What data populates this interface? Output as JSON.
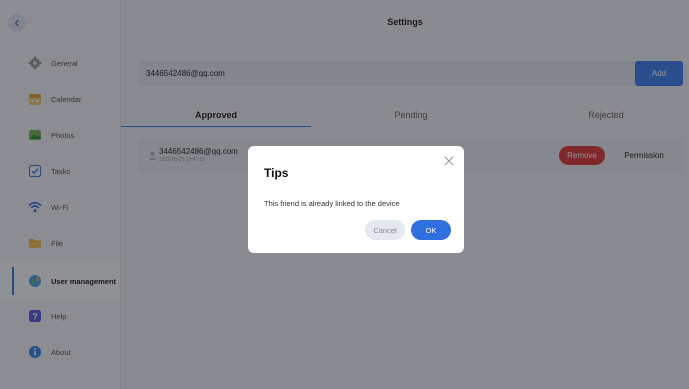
{
  "header": {
    "title": "Settings"
  },
  "sidebar": {
    "items": [
      {
        "label": "General",
        "icon": "gear-icon"
      },
      {
        "label": "Calendar",
        "icon": "calendar-icon"
      },
      {
        "label": "Photos",
        "icon": "photos-icon"
      },
      {
        "label": "Tasks",
        "icon": "tasks-icon"
      },
      {
        "label": "Wi-Fi",
        "icon": "wifi-icon"
      },
      {
        "label": "File",
        "icon": "folder-icon"
      },
      {
        "label": "User management",
        "icon": "user-management-icon"
      },
      {
        "label": "Help",
        "icon": "help-icon"
      },
      {
        "label": "About",
        "icon": "about-icon"
      }
    ],
    "active": "User management"
  },
  "add_row": {
    "email": "3446542486@qq.com",
    "add_label": "Add"
  },
  "tabs": [
    {
      "label": "Approved"
    },
    {
      "label": "Pending"
    },
    {
      "label": "Rejected"
    }
  ],
  "users": [
    {
      "email": "3446542486@qq.com",
      "time": "2025-03-21 10:41:21",
      "remove_label": "Remove",
      "permission_label": "Permission"
    }
  ],
  "dialog": {
    "title": "Tips",
    "message": "This friend is already linked to the device",
    "cancel_label": "Cancel",
    "ok_label": "OK"
  },
  "colors": {
    "accent": "#3f7ff0",
    "danger": "#e23a3a"
  }
}
